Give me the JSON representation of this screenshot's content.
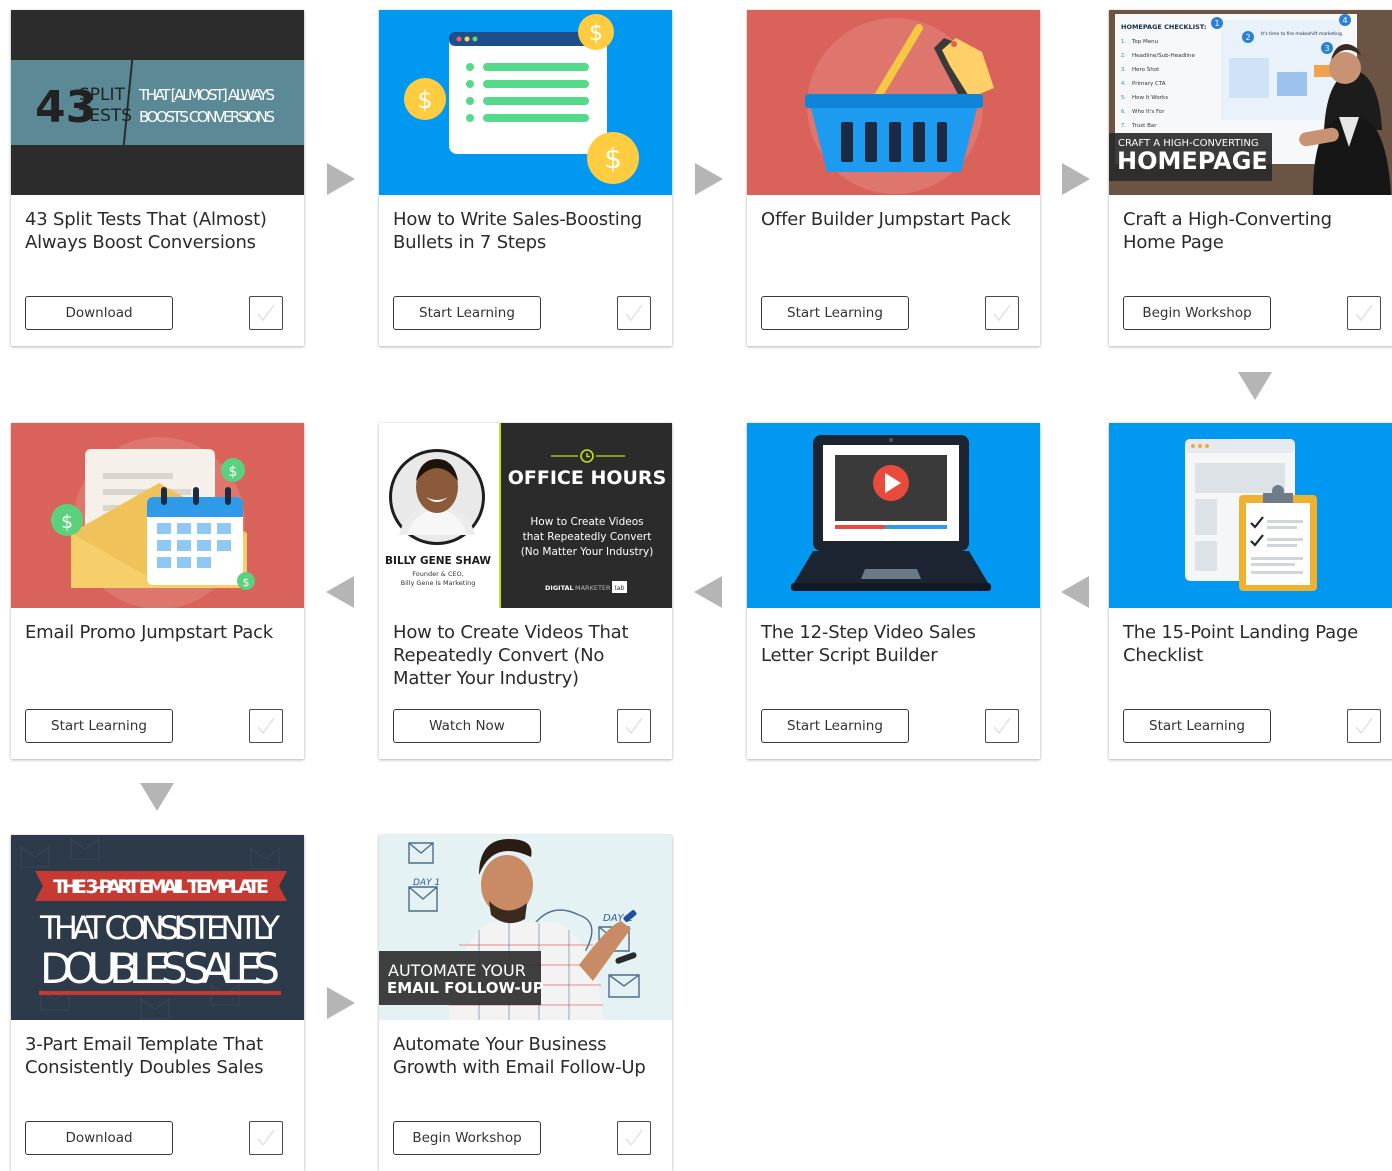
{
  "cards": [
    {
      "title": "43 Split Tests That (Almost) Always Boost Conversions",
      "button": "Download",
      "thumb": {
        "number": "43",
        "word1": "SPLIT",
        "word2": "TESTS",
        "line1": "THAT [ALMOST] ALWAYS",
        "line2": "BOOSTS CONVERSIONS"
      }
    },
    {
      "title": "How to Write Sales-Boosting Bullets in 7 Steps",
      "button": "Start Learning",
      "thumb": {
        "currency": "$"
      }
    },
    {
      "title": "Offer Builder Jumpstart Pack",
      "button": "Start Learning"
    },
    {
      "title": "Craft a High-Converting Home Page",
      "button": "Begin Workshop",
      "thumb": {
        "overlay_small": "CRAFT A HIGH-CONVERTING",
        "overlay_big": "HOMEPAGE",
        "checklist_title": "HOMEPAGE CHECKLIST:",
        "checklist_items": [
          "Top Menu",
          "Headline/Sub-Headline",
          "Hero Shot",
          "Primary CTA",
          "How It Works",
          "Who It's For",
          "Trust Bar"
        ],
        "bubble": "It's time to fire makeshift marketing."
      }
    },
    {
      "title": "The 15-Point Landing Page Checklist",
      "button": "Start Learning"
    },
    {
      "title": "The 12-Step Video Sales Letter Script Builder",
      "button": "Start Learning"
    },
    {
      "title": "How to Create Videos That Repeatedly Convert (No Matter Your Industry)",
      "button": "Watch Now",
      "thumb": {
        "name": "BILLY GENE SHAW",
        "role1": "Founder & CEO,",
        "role2": "Billy Gene Is Marketing",
        "heading": "OFFICE HOURS",
        "sub1": "How to Create Videos",
        "sub2": "that Repeatedly Convert",
        "sub3": "(No Matter Your Industry)",
        "brand_a": "DIGITAL",
        "brand_b": "MARKETER",
        "brand_c": "lab"
      }
    },
    {
      "title": "Email Promo Jumpstart Pack",
      "button": "Start Learning",
      "thumb": {
        "currency": "$"
      }
    },
    {
      "title": "3-Part Email Template That Consistently Doubles Sales",
      "button": "Download",
      "thumb": {
        "banner": "THE 3-PART EMAIL TEMPLATE",
        "line1": "THAT CONSISTENTLY",
        "line2": "DOUBLES SALES"
      }
    },
    {
      "title": "Automate Your Business Growth with Email Follow-Up",
      "button": "Begin Workshop",
      "thumb": {
        "overlay_small": "AUTOMATE YOUR",
        "overlay_big": "EMAIL FOLLOW-UP",
        "board1": "DAY 1",
        "board2": "DAY 2"
      }
    }
  ],
  "colors": {
    "red": "#d9625a",
    "blue": "#0098f0",
    "dark": "#2d3a4a"
  }
}
